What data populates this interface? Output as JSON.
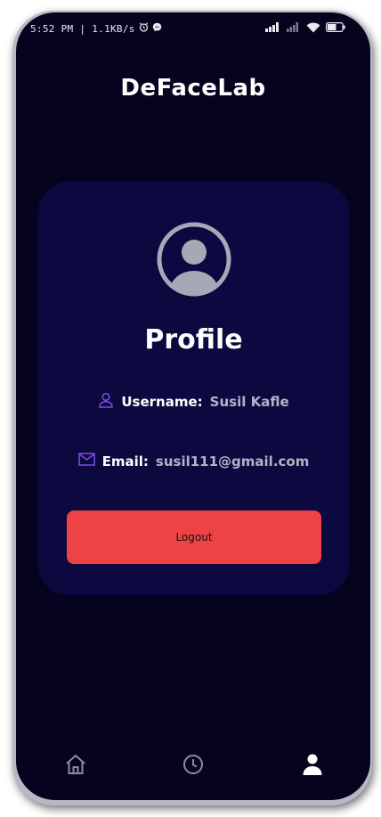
{
  "status_bar": {
    "left_text": "5:52 PM | 1.1KB/s",
    "battery": "53"
  },
  "app": {
    "title": "DeFaceLab"
  },
  "profile": {
    "heading": "Profile",
    "username_label": "Username:",
    "username_value": "Susil Kafle",
    "email_label": "Email:",
    "email_value": "susil111@gmail.com",
    "logout_label": "Logout"
  },
  "bottom_nav": {
    "items": [
      {
        "icon": "home-icon",
        "active": false
      },
      {
        "icon": "clock-icon",
        "active": false
      },
      {
        "icon": "person-icon",
        "active": true
      }
    ]
  },
  "colors": {
    "background": "#06031f",
    "card": "#0c0940",
    "accent_icon": "#7b4fe0",
    "logout_button": "#ee4244",
    "muted_text": "#b3b3c7"
  }
}
